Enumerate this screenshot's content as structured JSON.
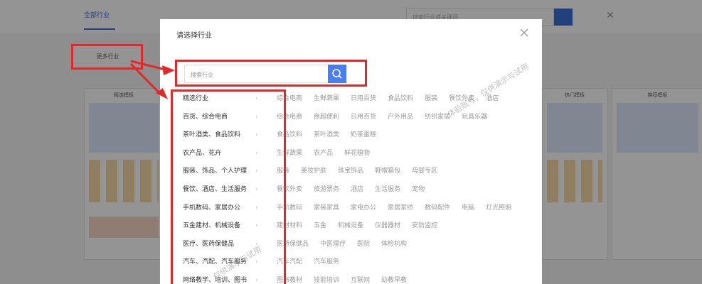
{
  "background": {
    "tab": "全部行业",
    "search_placeholder": "搜索行业或关键词",
    "filter_label": "更多行业",
    "card_titles": [
      "精选模板",
      "热门模板",
      "推荐模板"
    ]
  },
  "modal": {
    "title": "请选择行业",
    "search_placeholder": "搜索行业",
    "categories": [
      {
        "label": "精选行业",
        "subs": [
          "综合电商",
          "生鲜蔬果",
          "日用百货",
          "食品饮料",
          "服装",
          "餐饮外卖",
          "酒店"
        ]
      },
      {
        "label": "百货、综合电商",
        "subs": [
          "综合电商",
          "商超便利",
          "日用百货",
          "户外用品",
          "纺织家居",
          "玩具乐器"
        ]
      },
      {
        "label": "茶叶酒类、食品饮料",
        "subs": [
          "食品饮料",
          "茶叶酒类",
          "奶茶蛋糕"
        ]
      },
      {
        "label": "农产品、花卉",
        "subs": [
          "生鲜蔬果",
          "农产品",
          "鲜花植物"
        ]
      },
      {
        "label": "服装、饰品、个人护理",
        "subs": [
          "服装",
          "美妆护肤",
          "珠宝饰品",
          "鞋帽箱包",
          "母婴专区"
        ]
      },
      {
        "label": "餐饮、酒店、生活服务",
        "subs": [
          "餐饮外卖",
          "旅游票务",
          "酒店",
          "生活服务",
          "宠物"
        ]
      },
      {
        "label": "手机数码、家居办公",
        "subs": [
          "手机数码",
          "家装家具",
          "家电办公",
          "家居家纺",
          "数码配件",
          "电脑",
          "灯光照明"
        ]
      },
      {
        "label": "五金建材、机械设备",
        "subs": [
          "建材材料",
          "五金",
          "机械设备",
          "仪器器材",
          "安防监控"
        ]
      },
      {
        "label": "医疗、医药保健品",
        "subs": [
          "医药保健品",
          "中医理疗",
          "医院",
          "体检机构"
        ]
      },
      {
        "label": "汽车、汽配、汽车服务",
        "subs": [
          "汽车汽配",
          "汽车服务"
        ]
      },
      {
        "label": "网络教学、培训、图书",
        "subs": [
          "图书教材",
          "技能培训",
          "互联网",
          "幼教早教"
        ]
      }
    ]
  },
  "watermark": "仅供演示与试用",
  "watermark_alt": "体验账号，仅供演示与试用",
  "colors": {
    "accent": "#4a7df0",
    "annotation": "#e02a2a"
  }
}
